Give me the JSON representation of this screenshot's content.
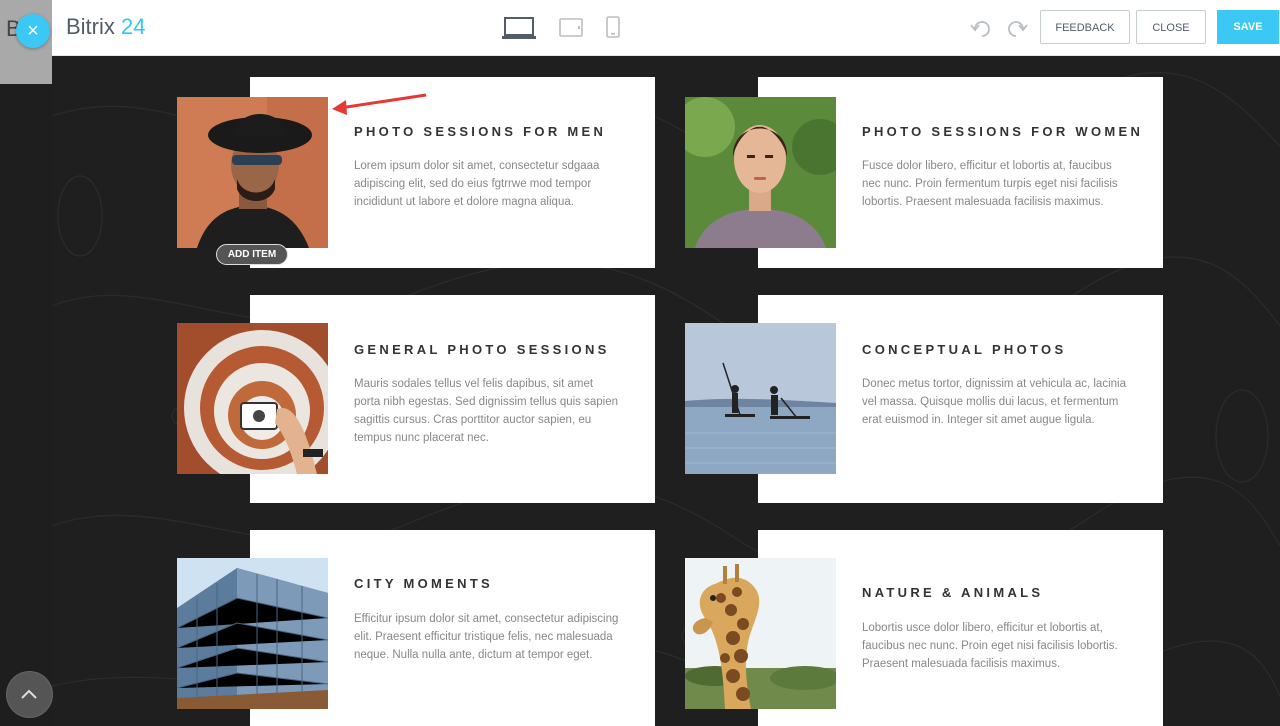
{
  "background": {
    "letter": "B"
  },
  "header": {
    "logo_text": "Bitrix",
    "logo_number": "24",
    "feedback_label": "FEEDBACK",
    "close_label": "CLOSE",
    "save_label": "SAVE",
    "close_icon": "×",
    "accent_color": "#3bc8f5"
  },
  "editor": {
    "add_item_label": "ADD ITEM"
  },
  "cards": [
    {
      "title": "PHOTO SESSIONS FOR MEN",
      "text": "Lorem ipsum dolor sit amet, consectetur sdgaaa adipiscing elit, sed do eius fgtrrwe mod tempor incididunt ut labore et dolore magna aliqua."
    },
    {
      "title": "PHOTO SESSIONS FOR WOMEN",
      "text": "Fusce dolor libero, efficitur et lobortis at, faucibus nec nunc. Proin fermentum turpis eget nisi facilisis lobortis. Praesent malesuada facilisis maximus."
    },
    {
      "title": "GENERAL PHOTO SESSIONS",
      "text": "Mauris sodales tellus vel felis dapibus, sit amet porta nibh egestas. Sed dignissim tellus quis sapien sagittis cursus. Cras porttitor auctor sapien, eu tempus nunc placerat nec."
    },
    {
      "title": "CONCEPTUAL PHOTOS",
      "text": "Donec metus tortor, dignissim at vehicula ac, lacinia vel massa. Quisque mollis dui lacus, et fermentum erat euismod in. Integer sit amet augue ligula."
    },
    {
      "title": "CITY MOMENTS",
      "text": "Efficitur ipsum dolor sit amet, consectetur adipiscing elit. Praesent efficitur tristique felis, nec malesuada neque. Nulla nulla ante, dictum at tempor eget."
    },
    {
      "title": "NATURE & ANIMALS",
      "text": "Lobortis usce dolor libero, efficitur et lobortis at, faucibus nec nunc. Proin eget nisi facilisis lobortis. Praesent malesuada facilisis maximus."
    }
  ]
}
